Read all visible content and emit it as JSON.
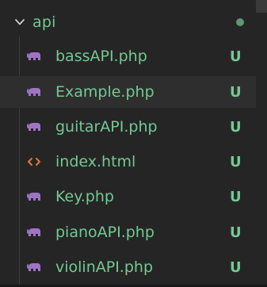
{
  "folder": {
    "name": "api",
    "chevron_icon": "chevron-down-icon",
    "status_dot_color": "#73c991"
  },
  "files": [
    {
      "name": "bassAPI.php",
      "status": "U",
      "icon": "php-elephant-icon"
    },
    {
      "name": "Example.php",
      "status": "U",
      "icon": "php-elephant-icon"
    },
    {
      "name": "guitarAPI.php",
      "status": "U",
      "icon": "php-elephant-icon"
    },
    {
      "name": "index.html",
      "status": "U",
      "icon": "html-code-icon"
    },
    {
      "name": "Key.php",
      "status": "U",
      "icon": "php-elephant-icon"
    },
    {
      "name": "pianoAPI.php",
      "status": "U",
      "icon": "php-elephant-icon"
    },
    {
      "name": "violinAPI.php",
      "status": "U",
      "icon": "php-elephant-icon"
    }
  ],
  "colors": {
    "untracked_text": "#73c991",
    "php_icon": "#a074c4",
    "html_icon": "#e37933",
    "background": "#252526",
    "hover_row": "#2e2e2f"
  }
}
